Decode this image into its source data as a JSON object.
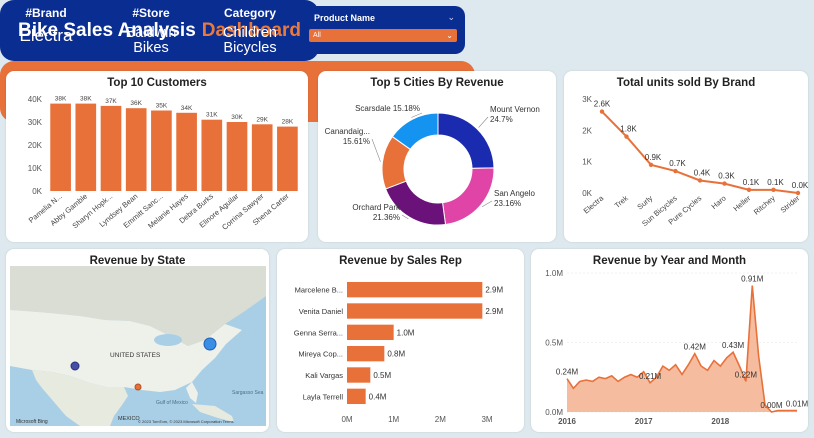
{
  "header": {
    "title_part1": "Bike Sales Analysis",
    "title_part2": "Dashboard"
  },
  "kpis": [
    {
      "label": "#Brand",
      "value": "Electra"
    },
    {
      "label": "#Store",
      "value": "Baldwin\nBikes"
    },
    {
      "label": "Category",
      "value": "Children\nBicycles"
    }
  ],
  "slicer": {
    "label": "Product Name",
    "value": "All"
  },
  "colors": {
    "accent": "#e8713a",
    "navy": "#0a2d91",
    "background": "#dde9ee"
  },
  "map": {
    "title": "Revenue by State",
    "labels": [
      "UNITED STATES",
      "MEXICO",
      "Gulf of Mexico",
      "Sargasso Sea"
    ],
    "credit": "© 2023 TomTom, © 2023 Microsoft Corporation Terms",
    "brand": "Microsoft Bing"
  },
  "chart_data": [
    {
      "type": "bar",
      "title": "Top 10 Customers",
      "categories": [
        "Pamelia N...",
        "Abby Gamble",
        "Sharyn Hopk...",
        "Lyndsey Bean",
        "Emmitt Sanc...",
        "Melanie Hayes",
        "Debra Burks",
        "Elinore Aguilar",
        "Corrina Sawyer",
        "Shena Carter"
      ],
      "values": [
        38,
        38,
        37,
        36,
        35,
        34,
        31,
        30,
        29,
        28
      ],
      "data_labels": [
        "38K",
        "38K",
        "37K",
        "36K",
        "35K",
        "34K",
        "31K",
        "30K",
        "29K",
        "28K"
      ],
      "y_ticks": [
        "0K",
        "10K",
        "20K",
        "30K",
        "40K"
      ],
      "ylim": [
        0,
        40
      ]
    },
    {
      "type": "pie",
      "title": "Top 5 Cities By Revenue",
      "categories": [
        "Mount Vernon",
        "San Angelo",
        "Orchard Park",
        "Canandaig...",
        "Scarsdale"
      ],
      "values": [
        24.7,
        23.16,
        21.36,
        15.61,
        15.18
      ],
      "data_labels": [
        "24.7%",
        "23.16%",
        "21.36%",
        "15.61%",
        "15.18%"
      ],
      "colors": [
        "#1a2bb0",
        "#e044a6",
        "#6a1279",
        "#e8713a",
        "#1493f0"
      ]
    },
    {
      "type": "line",
      "title": "Total units sold By Brand",
      "categories": [
        "Electra",
        "Trek",
        "Surly",
        "Sun Bicycles",
        "Pure Cycles",
        "Haro",
        "Heller",
        "Ritchey",
        "Strider"
      ],
      "values": [
        2.6,
        1.8,
        0.9,
        0.7,
        0.4,
        0.3,
        0.1,
        0.1,
        0.0
      ],
      "data_labels": [
        "2.6K",
        "1.8K",
        "0.9K",
        "0.7K",
        "0.4K",
        "0.3K",
        "0.1K",
        "0.1K",
        "0.0K"
      ],
      "y_ticks": [
        "0K",
        "1K",
        "2K",
        "3K"
      ],
      "ylim": [
        0,
        3
      ]
    },
    {
      "type": "bar",
      "orientation": "horizontal",
      "title": "Revenue by Sales Rep",
      "categories": [
        "Marcelene B...",
        "Venita Daniel",
        "Genna Serra...",
        "Mireya Cop...",
        "Kali Vargas",
        "Layla Terrell"
      ],
      "values": [
        2.9,
        2.9,
        1.0,
        0.8,
        0.5,
        0.4
      ],
      "data_labels": [
        "2.9M",
        "2.9M",
        "1.0M",
        "0.8M",
        "0.5M",
        "0.4M"
      ],
      "x_ticks": [
        "0M",
        "1M",
        "2M",
        "3M"
      ],
      "xlim": [
        0,
        3
      ]
    },
    {
      "type": "area",
      "title": "Revenue by Year and Month",
      "x_ticks": [
        "2016",
        "2017",
        "2018"
      ],
      "y_ticks": [
        "0.0M",
        "0.5M",
        "1.0M"
      ],
      "ylim": [
        0,
        1.0
      ],
      "values": [
        0.24,
        0.17,
        0.22,
        0.23,
        0.22,
        0.25,
        0.24,
        0.26,
        0.22,
        0.25,
        0.27,
        0.25,
        0.29,
        0.21,
        0.25,
        0.33,
        0.3,
        0.34,
        0.27,
        0.34,
        0.42,
        0.33,
        0.3,
        0.37,
        0.33,
        0.39,
        0.43,
        0.33,
        0.22,
        0.91,
        0.4,
        0.05,
        0.0,
        0.01,
        0.01,
        0.01,
        0.01
      ],
      "annotations": [
        {
          "index": 0,
          "label": "0.24M"
        },
        {
          "index": 13,
          "label": "0.21M"
        },
        {
          "index": 20,
          "label": "0.42M"
        },
        {
          "index": 26,
          "label": "0.43M"
        },
        {
          "index": 28,
          "label": "0.22M"
        },
        {
          "index": 29,
          "label": "0.91M"
        },
        {
          "index": 32,
          "label": "0.00M"
        },
        {
          "index": 36,
          "label": "0.01M"
        }
      ]
    }
  ]
}
